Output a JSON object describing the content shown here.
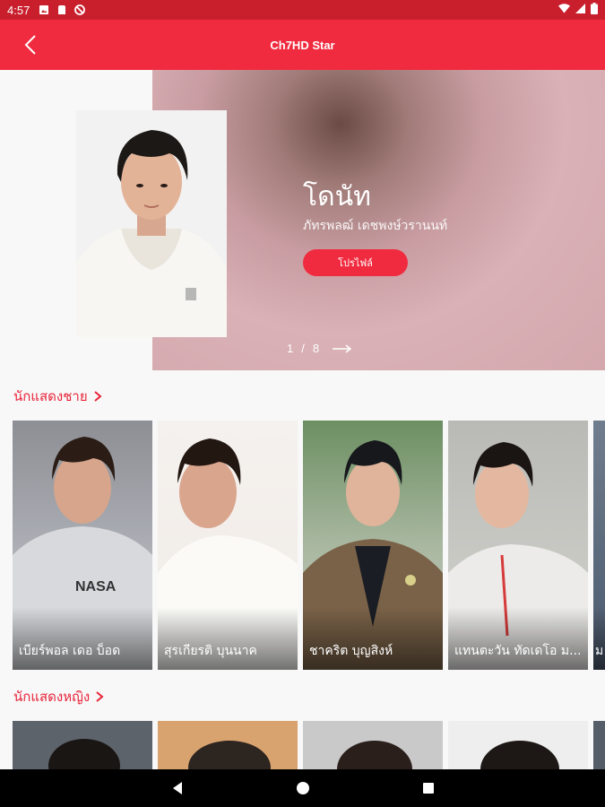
{
  "status": {
    "time": "4:57"
  },
  "header": {
    "title": "Ch7HD Star"
  },
  "hero": {
    "name": "โดนัท",
    "fullname": "ภัทรพลฒ์ เดชพงษ์วรานนท์",
    "button_label": "โปรไฟล์",
    "pager_current": "1",
    "pager_sep": "/",
    "pager_total": "8"
  },
  "male_section": {
    "title": "นักแสดงชาย",
    "cards": [
      {
        "name": "เบียร์พอล เดอ บ็อด"
      },
      {
        "name": "สุรเกียรติ บุนนาค"
      },
      {
        "name": "ชาคริต บุญสิงห์"
      },
      {
        "name": "แทนตะวัน ทัดเดโอ ม..."
      },
      {
        "name": "ม"
      }
    ]
  },
  "female_section": {
    "title": "นักแสดงหญิง"
  },
  "colors": {
    "accent": "#f12b3f",
    "status": "#c91f2d"
  }
}
